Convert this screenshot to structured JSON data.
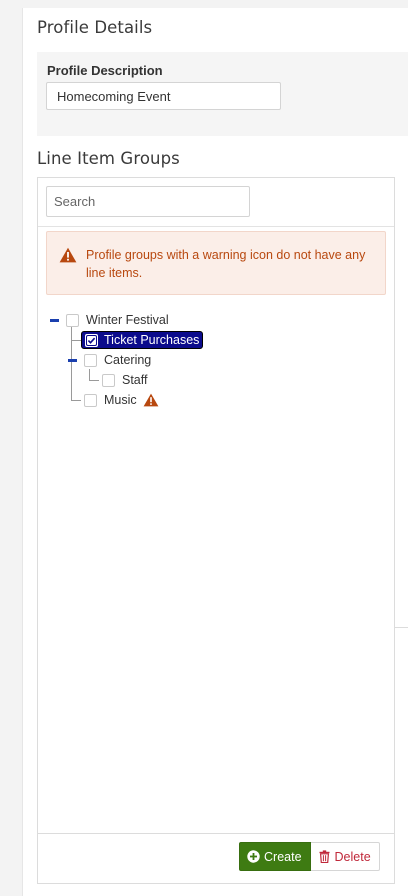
{
  "profile": {
    "title": "Profile Details",
    "description_label": "Profile Description",
    "description_value": "Homecoming Event"
  },
  "groups": {
    "title": "Line Item Groups",
    "search_placeholder": "Search",
    "warning_text": "Profile groups with a warning icon do not have any line items.",
    "tree": [
      {
        "label": "Winter Festival",
        "checked": false
      },
      {
        "label": "Ticket Purchases",
        "checked": true,
        "selected": true
      },
      {
        "label": "Catering",
        "checked": false
      },
      {
        "label": "Staff",
        "checked": false
      },
      {
        "label": "Music",
        "checked": false,
        "warning": true
      }
    ],
    "create_label": "Create",
    "delete_label": "Delete"
  },
  "colors": {
    "accent_warning": "#b8480f",
    "create_button": "#3e7b12",
    "delete_text": "#c0283a",
    "selected_node": "#0b0b8c",
    "tree_toggle": "#1a3fae"
  },
  "icons": {
    "alert": "warning-triangle-icon",
    "create": "plus-circle-icon",
    "delete": "trash-icon"
  }
}
